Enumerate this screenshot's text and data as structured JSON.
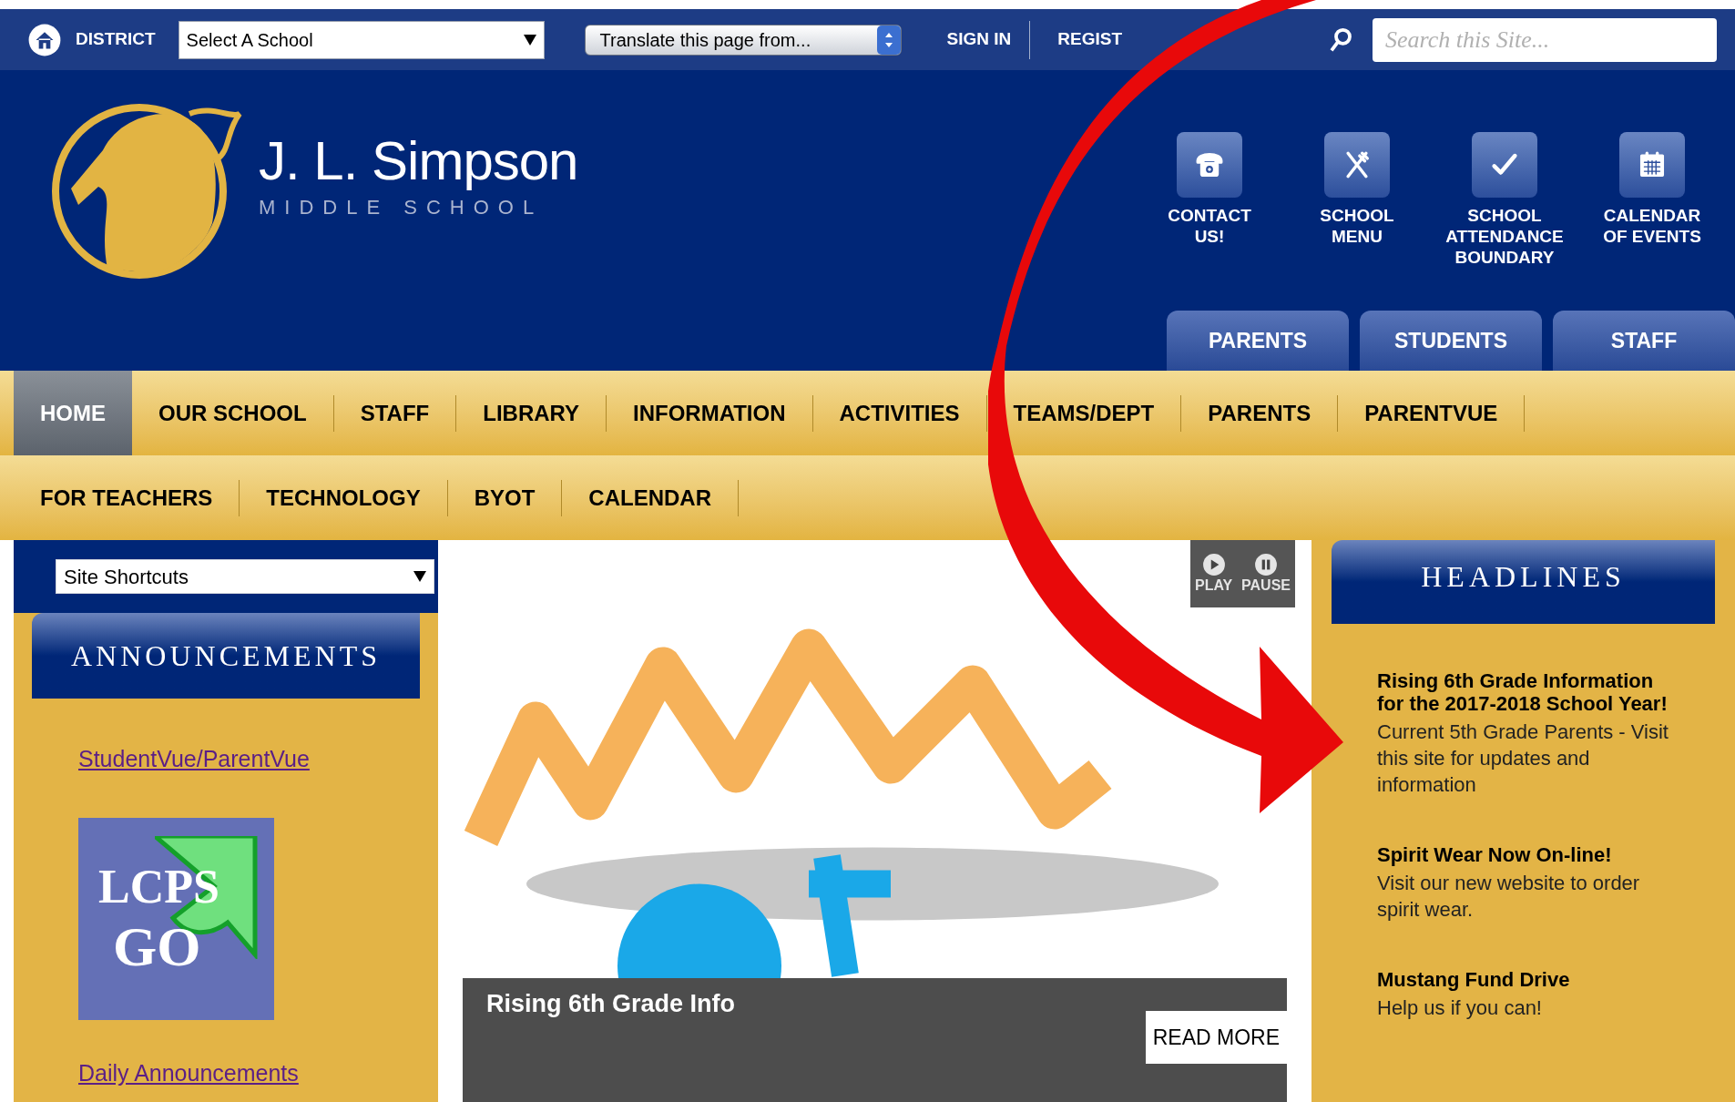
{
  "top_bar": {
    "district_link": "DISTRICT",
    "school_select": {
      "value": "Select A School"
    },
    "translate_select": {
      "value": "Translate this page from..."
    },
    "links": [
      "SIGN IN",
      "REGIST"
    ],
    "search": {
      "placeholder": "Search this Site..."
    }
  },
  "header": {
    "school_name": "J. L. Simpson",
    "school_subtitle": "MIDDLE SCHOOL",
    "quick_links": [
      {
        "kind": "phone",
        "label": "CONTACT US!"
      },
      {
        "kind": "menu",
        "label": "SCHOOL MENU"
      },
      {
        "kind": "check",
        "label": "SCHOOL ATTENDANCE BOUNDARY"
      },
      {
        "kind": "calendar",
        "label": "CALENDAR OF EVENTS"
      }
    ],
    "audience_tabs": [
      "PARENTS",
      "STUDENTS",
      "STAFF"
    ]
  },
  "nav": {
    "primary_items": [
      {
        "label": "HOME",
        "selected": true
      },
      {
        "label": "OUR SCHOOL",
        "selected": false
      },
      {
        "label": "STAFF",
        "selected": false
      },
      {
        "label": "LIBRARY",
        "selected": false
      },
      {
        "label": "INFORMATION",
        "selected": false
      },
      {
        "label": "ACTIVITIES",
        "selected": false
      },
      {
        "label": "TEAMS/DEPT",
        "selected": false
      },
      {
        "label": "PARENTS",
        "selected": false
      },
      {
        "label": "PARENTVUE",
        "selected": false
      }
    ],
    "secondary_items": [
      {
        "label": "FOR TEACHERS",
        "selected": false
      },
      {
        "label": "TECHNOLOGY",
        "selected": false
      },
      {
        "label": "BYOT",
        "selected": false
      },
      {
        "label": "CALENDAR",
        "selected": false
      }
    ]
  },
  "sidebar": {
    "shortcuts_select": {
      "value": "Site Shortcuts"
    },
    "heading": "ANNOUNCEMENTS",
    "links": [
      "StudentVue/ParentVue",
      "Daily Announcements"
    ],
    "app_tile": {
      "lines": [
        "LCPS",
        "GO"
      ]
    }
  },
  "slideshow": {
    "controls": [
      {
        "kind": "play",
        "label": "PLAY"
      },
      {
        "kind": "pause",
        "label": "PAUSE"
      }
    ],
    "caption": "Rising 6th Grade Info",
    "button": "READ MORE"
  },
  "headlines": {
    "heading": "HEADLINES",
    "items": [
      {
        "title": "Rising 6th Grade Information for the 2017-2018 School Year!",
        "body": "Current 5th Grade Parents - Visit this site for updates and information"
      },
      {
        "title": "Spirit Wear Now On-line!",
        "body": "Visit our new website to order spirit wear."
      },
      {
        "title": "Mustang Fund Drive",
        "body": "Help us if you can!"
      }
    ]
  }
}
